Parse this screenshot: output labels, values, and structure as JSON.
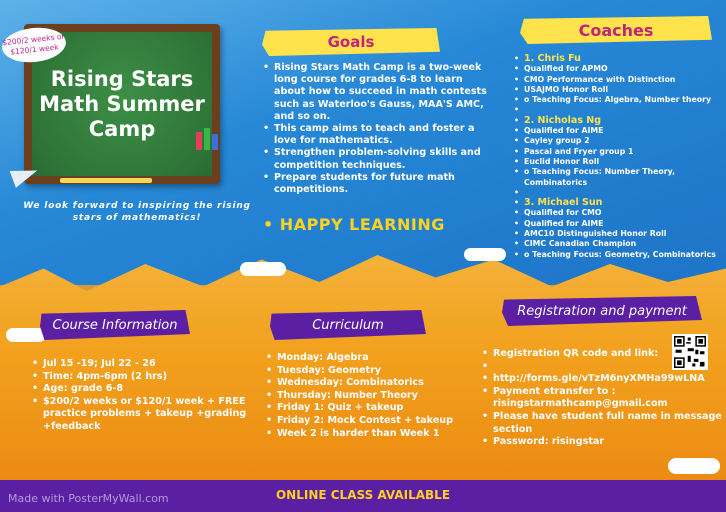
{
  "board": {
    "title_line1": "Rising Stars",
    "title_line2": "Math Summer",
    "title_line3": "Camp",
    "price_badge_line1": "$200/2 weeks or",
    "price_badge_line2": "$120/1 week"
  },
  "tagline": "We look forward to inspiring the rising stars of mathematics!",
  "goals": {
    "heading": "Goals",
    "items": [
      "Rising Stars Math Camp is a  two-week long course for grades 6-8 to learn about how to succeed in math contests such as Waterloo's Gauss, MAA'S AMC, and so on.",
      "This camp aims to teach and foster a love for mathematics.",
      "Strengthen problem-solving skills and competition techniques.",
      "Prepare students for future math competitions."
    ],
    "closing": "• HAPPY LEARNING"
  },
  "coaches": {
    "heading": "Coaches",
    "list": [
      {
        "name": "1.  Chris Fu",
        "items": [
          "Qualified for APMO",
          "CMO Performance with Distinction",
          "USAJMO Honor Roll",
          "o Teaching Focus: Algebra, Number theory"
        ]
      },
      {
        "name": "2.  Nicholas Ng",
        "items": [
          "Qualified for AIME",
          "Cayley group 2",
          "Pascal and Fryer group 1",
          "Euclid Honor Roll",
          "o Teaching Focus: Number Theory, Combinatorics"
        ]
      },
      {
        "name": "3.  Michael Sun",
        "items": [
          "Qualified for CMO",
          "Qualified for AIME",
          "AMC10 Distinguished Honor Roll",
          "CIMC Canadian Champion",
          "o Teaching Focus: Geometry, Combinatorics"
        ]
      }
    ]
  },
  "course_info": {
    "heading": "Course Information",
    "items": [
      "Jul 15 -19; Jul 22 - 26",
      "Time: 4pm-6pm (2 hrs)",
      "Age: grade 6-8",
      "$200/2 weeks or $120/1 week + FREE practice problems + takeup +grading +feedback"
    ]
  },
  "curriculum": {
    "heading": "Curriculum",
    "items": [
      "Monday: Algebra",
      "Tuesday: Geometry",
      "Wednesday: Combinatorics",
      "Thursday: Number Theory",
      "Friday 1: Quiz + takeup",
      "Friday 2: Mock Contest + takeup",
      "Week 2 is harder than Week 1"
    ]
  },
  "registration": {
    "heading": "Registration and payment",
    "items": [
      "Registration QR code and link:",
      "",
      "http://forms.gle/vTzM6nyXMHa99wLNA",
      "Payment etransfer to : risingstarmathcamp@gmail.com",
      "Please have student full name in message section",
      "Password: risingstar"
    ]
  },
  "footer": {
    "online": "ONLINE CLASS AVAILABLE",
    "watermark": "Made with PosterMyWall.com"
  },
  "colors": {
    "header_yellow": "#ffe34d",
    "header_purple": "#5b1fa3",
    "heading_pink": "#c3237a",
    "accent_yellow": "#ffd31f"
  }
}
